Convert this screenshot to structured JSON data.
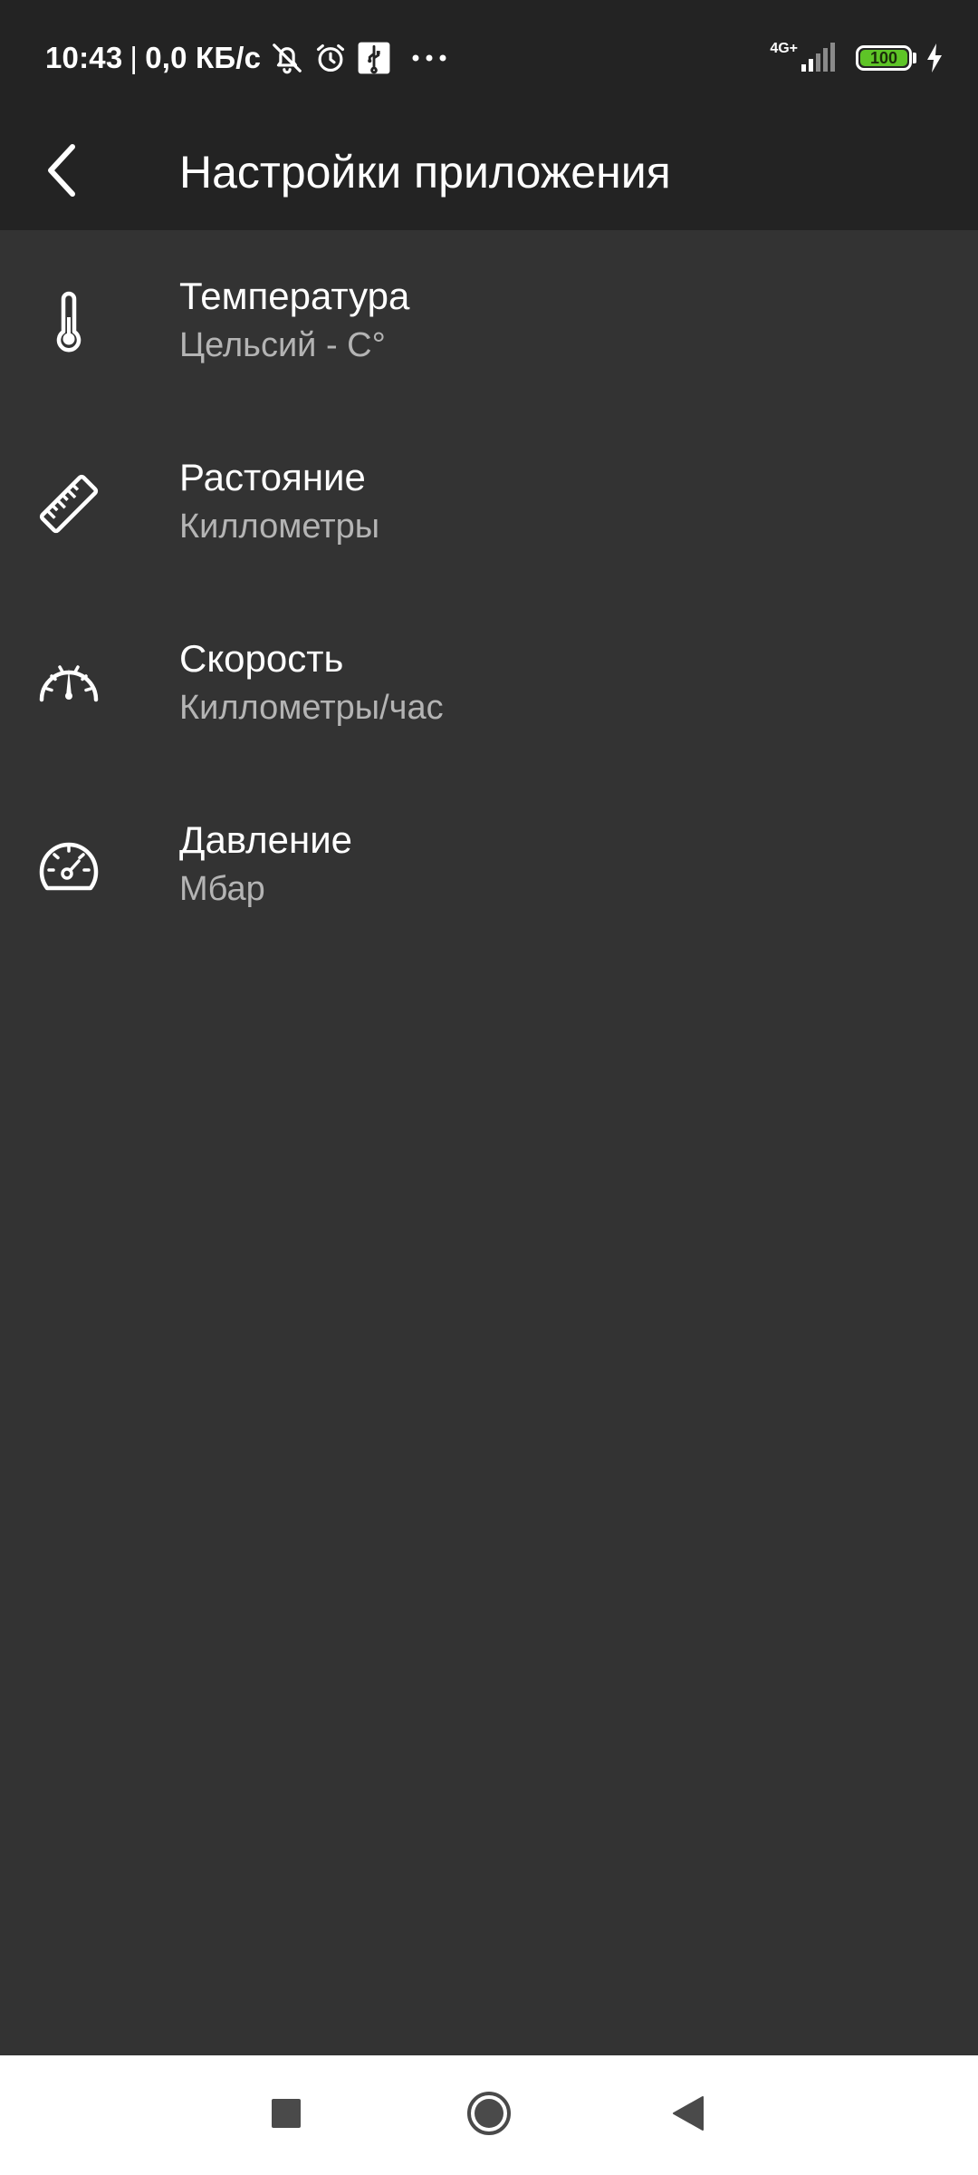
{
  "status_bar": {
    "time": "10:43",
    "separator": "|",
    "network_speed": "0,0 КБ/с",
    "network_type": "4G+",
    "battery_level": "100",
    "battery_fraction": 1.0,
    "icons": [
      "muted-notifications-icon",
      "alarm-icon",
      "usb-icon",
      "more-dots-icon",
      "signal-icon",
      "battery-icon",
      "charging-icon"
    ]
  },
  "toolbar": {
    "title": "Настройки приложения",
    "back_icon": "chevron-left-icon"
  },
  "settings": [
    {
      "id": "temperature",
      "title": "Температура",
      "value": "Цельсий - С°",
      "icon": "thermometer-icon"
    },
    {
      "id": "distance",
      "title": "Растояние",
      "value": "Киллометры",
      "icon": "ruler-icon"
    },
    {
      "id": "speed",
      "title": "Скорость",
      "value": "Киллометры/час",
      "icon": "speedometer-icon"
    },
    {
      "id": "pressure",
      "title": "Давление",
      "value": "Мбар",
      "icon": "pressure-gauge-icon"
    }
  ],
  "nav_bar": {
    "icons": [
      "recents-square-icon",
      "home-circle-icon",
      "back-triangle-icon"
    ]
  },
  "colors": {
    "background": "#333333",
    "toolbar": "#232323",
    "primary_text": "#ffffff",
    "secondary_text": "#b4b4b4",
    "battery_green": "#5ec427",
    "nav_bar": "#ffffff"
  }
}
